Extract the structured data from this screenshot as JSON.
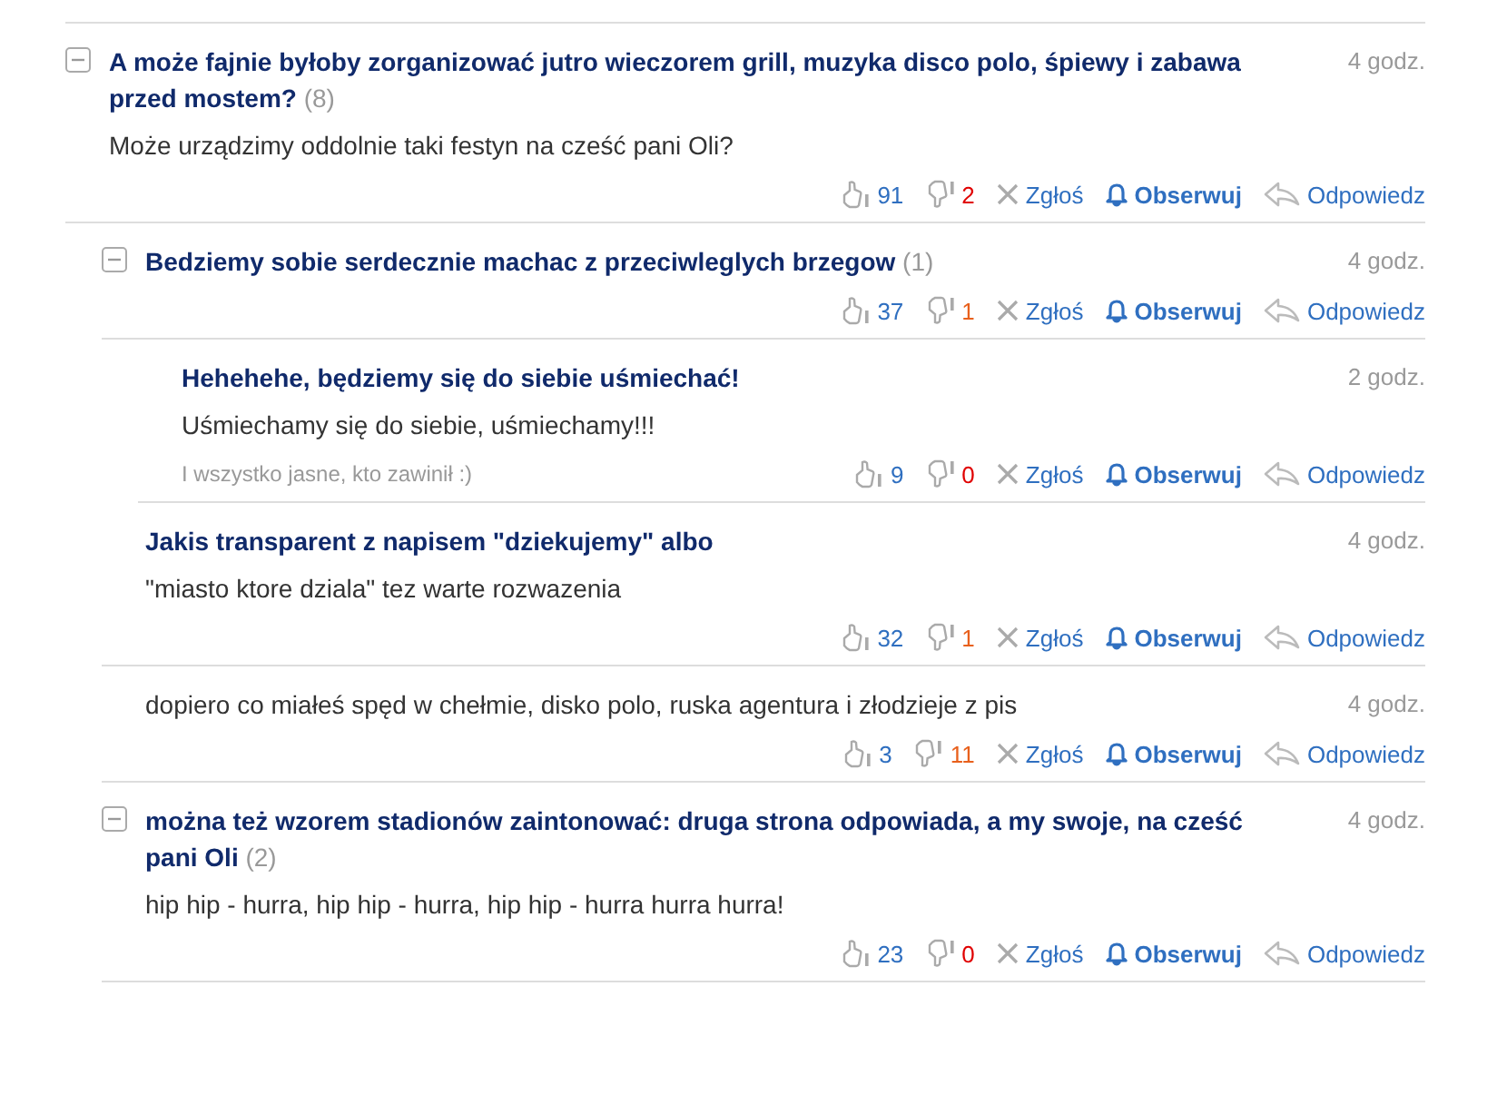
{
  "comments": [
    {
      "title": "A może fajnie byłoby zorganizować jutro wieczorem grill, muzyka disco polo, śpiewy i zabawa przed mostem?",
      "count": "(8)",
      "body": "Może urządzimy oddolnie taki festyn na cześć pani Oli?",
      "time": "4 godz.",
      "likes": "91",
      "dislikes": "2",
      "color": "#e00000",
      "report": "Zgłoś",
      "follow": "Obserwuj",
      "reply": "Odpowiedz",
      "expanded": true,
      "children": [
        {
          "title": "Bedziemy sobie serdecznie machac z przeciwleglych brzegow",
          "count": "(1)",
          "time": "4 godz.",
          "likes": "37",
          "dislikes": "1",
          "color": "#e8601c",
          "report": "Zgłoś",
          "follow": "Obserwuj",
          "reply": "Odpowiedz",
          "expanded": true,
          "children": [
            {
              "title": "Hehehehe, będziemy się do siebie uśmiechać!",
              "body": "Uśmiechamy się do siebie, uśmiechamy!!!",
              "signature": "I wszystko jasne, kto zawinił :)",
              "time": "2 godz.",
              "likes": "9",
              "dislikes": "0",
              "color": "#e00000",
              "report": "Zgłoś",
              "follow": "Obserwuj",
              "reply": "Odpowiedz"
            }
          ]
        },
        {
          "title": "Jakis transparent z napisem \"dziekujemy\" albo",
          "body": "\"miasto ktore dziala\" tez warte rozwazenia",
          "time": "4 godz.",
          "likes": "32",
          "dislikes": "1",
          "color": "#e8601c",
          "report": "Zgłoś",
          "follow": "Obserwuj",
          "reply": "Odpowiedz"
        },
        {
          "body": "dopiero co miałeś spęd w chełmie, disko polo, ruska agentura i złodzieje z pis",
          "time": "4 godz.",
          "likes": "3",
          "dislikes": "11",
          "color": "#e8601c",
          "report": "Zgłoś",
          "follow": "Obserwuj",
          "reply": "Odpowiedz"
        },
        {
          "title": "można też wzorem stadionów zaintonować: druga strona odpowiada, a my swoje, na cześć pani Oli",
          "count": "(2)",
          "body": "hip hip - hurra, hip hip - hurra, hip hip - hurra hurra hurra!",
          "time": "4 godz.",
          "likes": "23",
          "dislikes": "0",
          "color": "#e00000",
          "report": "Zgłoś",
          "follow": "Obserwuj",
          "reply": "Odpowiedz",
          "expanded": true
        }
      ]
    }
  ]
}
